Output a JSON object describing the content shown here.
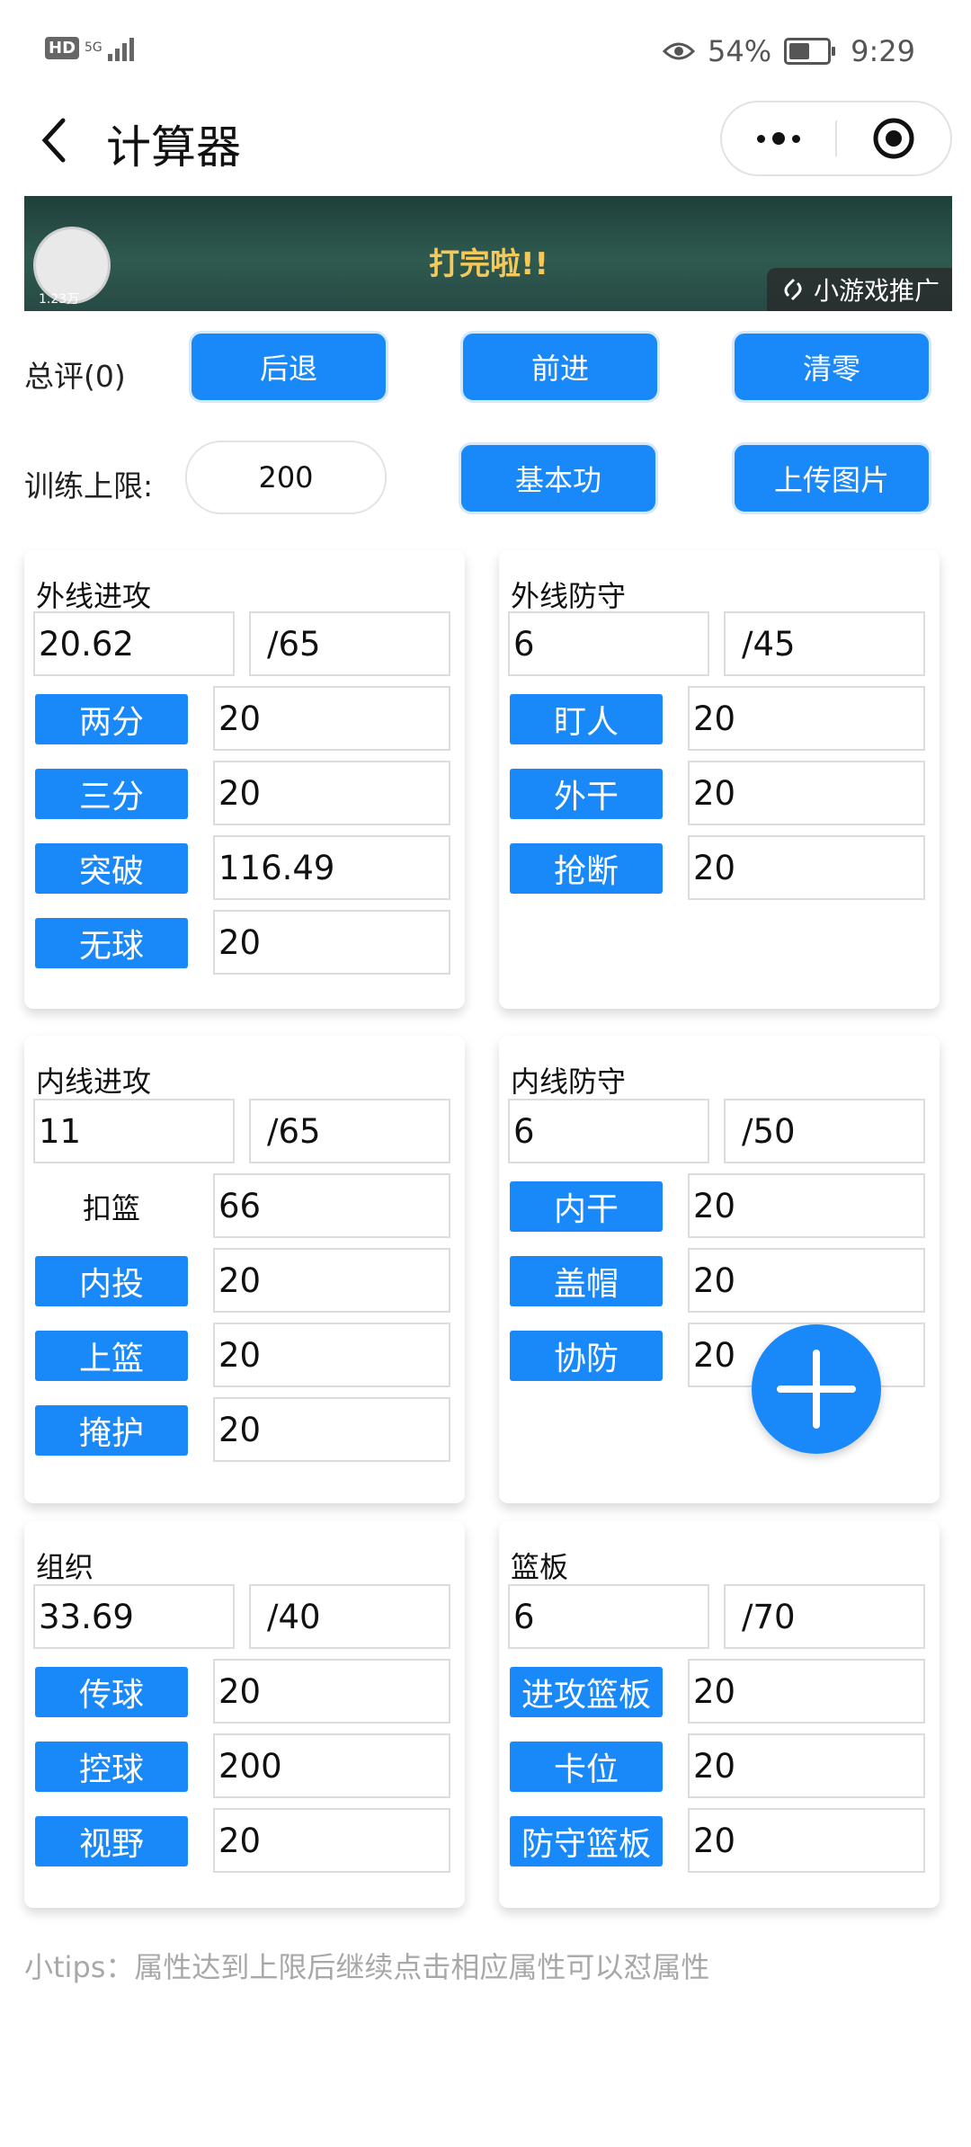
{
  "status_bar": {
    "hd": "HD",
    "network": "5G",
    "battery": "54%",
    "time": "9:29"
  },
  "nav": {
    "title": "计算器"
  },
  "banner": {
    "text": "打完啦!!",
    "coins": "1.23万",
    "ad_label": "小游戏推广"
  },
  "controls": {
    "rating_label": "总评(0)",
    "back_label": "后退",
    "forward_label": "前进",
    "clear_label": "清零",
    "limit_label": "训练上限:",
    "limit_value": "200",
    "basic_label": "基本功",
    "upload_label": "上传图片"
  },
  "cards": {
    "outside_offense": {
      "title": "外线进攻",
      "total": "20.62",
      "limit": "/65",
      "rows": [
        {
          "label": "两分",
          "value": "20"
        },
        {
          "label": "三分",
          "value": "20"
        },
        {
          "label": "突破",
          "value": "116.49"
        },
        {
          "label": "无球",
          "value": "20"
        }
      ]
    },
    "outside_defense": {
      "title": "外线防守",
      "total": "6",
      "limit": "/45",
      "rows": [
        {
          "label": "盯人",
          "value": "20"
        },
        {
          "label": "外干",
          "value": "20"
        },
        {
          "label": "抢断",
          "value": "20"
        }
      ]
    },
    "inside_offense": {
      "title": "内线进攻",
      "total": "11",
      "limit": "/65",
      "rows": [
        {
          "label": "扣篮",
          "value": "66"
        },
        {
          "label": "内投",
          "value": "20"
        },
        {
          "label": "上篮",
          "value": "20"
        },
        {
          "label": "掩护",
          "value": "20"
        }
      ]
    },
    "inside_defense": {
      "title": "内线防守",
      "total": "6",
      "limit": "/50",
      "rows": [
        {
          "label": "内干",
          "value": "20"
        },
        {
          "label": "盖帽",
          "value": "20"
        },
        {
          "label": "协防",
          "value": "20"
        }
      ]
    },
    "organize": {
      "title": "组织",
      "total": "33.69",
      "limit": "/40",
      "rows": [
        {
          "label": "传球",
          "value": "20"
        },
        {
          "label": "控球",
          "value": "200"
        },
        {
          "label": "视野",
          "value": "20"
        }
      ]
    },
    "rebound": {
      "title": "篮板",
      "total": "6",
      "limit": "/70",
      "rows": [
        {
          "label": "进攻篮板",
          "value": "20"
        },
        {
          "label": "卡位",
          "value": "20"
        },
        {
          "label": "防守篮板",
          "value": "20"
        }
      ]
    }
  },
  "tips": "小tips：属性达到上限后继续点击相应属性可以怼属性",
  "colors": {
    "accent": "#1989fa"
  }
}
